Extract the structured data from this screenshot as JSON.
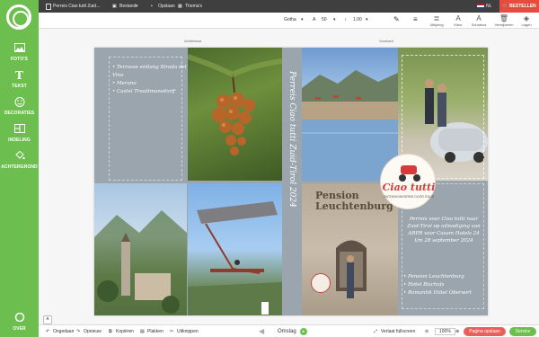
{
  "sidebar": {
    "items": [
      {
        "label": "FOTO'S"
      },
      {
        "label": "TEKST"
      },
      {
        "label": "DECORATIES"
      },
      {
        "label": "INDELING"
      },
      {
        "label": "ACHTERGROND"
      }
    ],
    "bottom_label": "OVER"
  },
  "topbar": {
    "doc_title": "Perreis Ciao tutti Zuid...",
    "menu_bestand": "Bestand",
    "menu_opslaan": "Opslaan",
    "menu_themas": "Thema's",
    "lang": "NL",
    "order_label": "BESTELLEN"
  },
  "toolbar": {
    "font": "Gotha",
    "size": "50",
    "line_height": "1.00",
    "tools": [
      {
        "label": "Uitlijning"
      },
      {
        "label": "Kleur"
      },
      {
        "label": "Schaduw"
      },
      {
        "label": "Verwijderen"
      },
      {
        "label": "Lagen"
      }
    ]
  },
  "canvas": {
    "left_page_label": "Achterkant",
    "right_page_label": "Voorkant",
    "places": [
      "Terrasse entlang Strada del Vino",
      "Merano",
      "Castel Trauttmansdorff"
    ],
    "spine_text": "Perreis Ciao tutti Zuid-Tirol 2024",
    "logo_title": "Ciao tutti",
    "logo_sub": "ONTDEKKINGSREIS DOOR ITALIË",
    "pension_sign": "Pension Leuchtenburg",
    "trip_text": "Perreis voor Ciao tutti naar Zuid-Tirol op uitnodiging van ARPR voor Casam Hotels 24 t/m 28 september 2024",
    "hotels": [
      "Pension Leuchtenburg",
      "Hotel Bischofs",
      "Romantik Hotel Oberwirt"
    ]
  },
  "bottombar": {
    "undo": "Ongedaan",
    "redo": "Opnieuw",
    "copy": "Kopiëren",
    "paste": "Plakken",
    "cut": "Uitknippen",
    "page_label": "Omslag",
    "fill": "Verlaat fullscreen",
    "zoom": "100%",
    "save": "Pagina opslaan",
    "service": "Service"
  },
  "colors": {
    "brand": "#6cbf4f",
    "accent": "#e84b3c",
    "topbar": "#3f3f3f"
  }
}
